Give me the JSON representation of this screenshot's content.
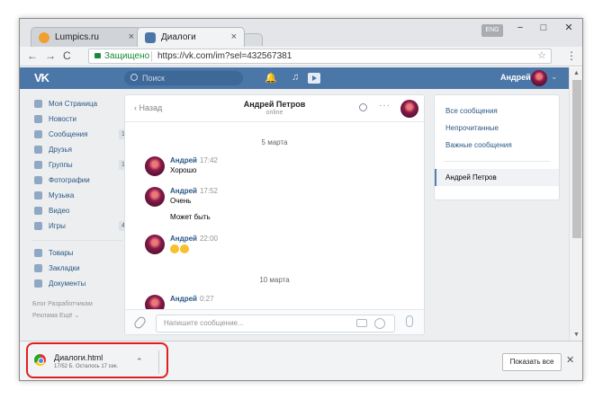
{
  "browser": {
    "tabs": [
      {
        "label": "Lumpics.ru",
        "close": "×"
      },
      {
        "label": "Диалоги",
        "close": "×"
      }
    ],
    "lang_badge": "ENG",
    "window_controls": {
      "minimize": "−",
      "restore": "□",
      "close": "✕"
    },
    "nav": {
      "back": "←",
      "forward": "→",
      "reload": "C"
    },
    "address": {
      "secure_label": "Защищено",
      "url": "https://vk.com/im?sel=432567381",
      "star": "☆"
    },
    "menu": "⋮"
  },
  "vk_header": {
    "logo": "VK",
    "search_placeholder": "Поиск",
    "user_name": "Андрей",
    "chevron": "⌄"
  },
  "sidebar": {
    "items": [
      {
        "label": "Моя Страница",
        "icon": "home-icon",
        "count": ""
      },
      {
        "label": "Новости",
        "icon": "news-icon",
        "count": ""
      },
      {
        "label": "Сообщения",
        "icon": "messages-icon",
        "count": "1"
      },
      {
        "label": "Друзья",
        "icon": "friends-icon",
        "count": ""
      },
      {
        "label": "Группы",
        "icon": "groups-icon",
        "count": "1"
      },
      {
        "label": "Фотографии",
        "icon": "photos-icon",
        "count": ""
      },
      {
        "label": "Музыка",
        "icon": "music-icon",
        "count": ""
      },
      {
        "label": "Видео",
        "icon": "video-icon",
        "count": ""
      },
      {
        "label": "Игры",
        "icon": "games-icon",
        "count": "4"
      }
    ],
    "items2": [
      {
        "label": "Товары",
        "icon": "bag-icon"
      },
      {
        "label": "Закладки",
        "icon": "star-icon"
      },
      {
        "label": "Документы",
        "icon": "doc-icon"
      }
    ],
    "footer": {
      "line1_a": "Блог",
      "line1_b": "Разработчикам",
      "line2_a": "Реклама",
      "line2_b": "Ещё ⌄"
    }
  },
  "chat": {
    "back_label": "Назад",
    "contact_name": "Андрей Петров",
    "contact_status": "online",
    "dots": "···",
    "days": [
      {
        "label": "5 марта"
      },
      {
        "label": "10 марта"
      }
    ],
    "messages": [
      {
        "author": "Андрей",
        "time": "17:42",
        "text": "Хорошо"
      },
      {
        "author": "Андрей",
        "time": "17:52",
        "text": "Очень"
      },
      {
        "text": "Может быть"
      },
      {
        "author": "Андрей",
        "time": "22:00",
        "text": ""
      },
      {
        "author": "Андрей",
        "time": "0:27",
        "text": ""
      }
    ],
    "composer_placeholder": "Напишите сообщение..."
  },
  "right_menu": {
    "items": [
      {
        "label": "Все сообщения"
      },
      {
        "label": "Непрочитанные"
      },
      {
        "label": "Важные сообщения"
      }
    ],
    "selected": "Андрей Петров"
  },
  "downloads": {
    "file_name": "Диалоги.html",
    "status": "17/52 Б. Осталось 17 сек.",
    "chevron": "⌃",
    "show_all": "Показать все",
    "close": "✕"
  },
  "colors": {
    "vk_blue": "#4a76a8",
    "link": "#2a5885",
    "highlight_ring": "#e02020"
  }
}
